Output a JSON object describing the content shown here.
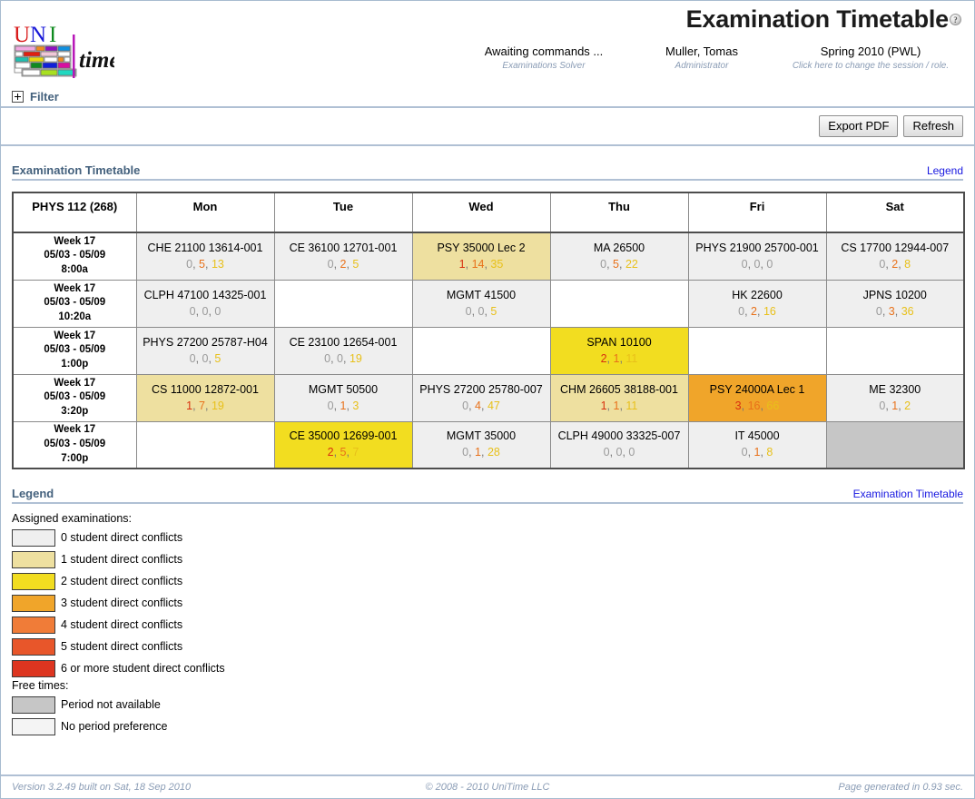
{
  "header": {
    "title": "Examination Timetable",
    "help_icon": "?",
    "status": [
      {
        "main": "Awaiting commands ...",
        "sub": "Examinations Solver"
      },
      {
        "main": "Muller, Tomas",
        "sub": "Administrator"
      },
      {
        "main": "Spring 2010 (PWL)",
        "sub": "Click here to change the session / role."
      }
    ]
  },
  "filter": {
    "label": "Filter"
  },
  "toolbar": {
    "export_label": "Export PDF",
    "refresh_label": "Refresh"
  },
  "timetable": {
    "section_title": "Examination Timetable",
    "section_link": "Legend",
    "corner_label": "PHYS 112 (268)",
    "days": [
      "Mon",
      "Tue",
      "Wed",
      "Thu",
      "Fri",
      "Sat"
    ],
    "rows": [
      {
        "week": "Week 17",
        "dates": "05/03 - 05/09",
        "time": "8:00a",
        "cells": [
          {
            "name": "CHE 21100 13614-001",
            "nums": [
              0,
              5,
              13
            ],
            "conflicts": 0
          },
          {
            "name": "CE 36100 12701-001",
            "nums": [
              0,
              2,
              5
            ],
            "conflicts": 0
          },
          {
            "name": "PSY 35000 Lec 2",
            "nums": [
              1,
              14,
              35
            ],
            "conflicts": 1
          },
          {
            "name": "MA 26500",
            "nums": [
              0,
              5,
              22
            ],
            "conflicts": 0
          },
          {
            "name": "PHYS 21900 25700-001",
            "nums": [
              0,
              0,
              0
            ],
            "conflicts": 0
          },
          {
            "name": "CS 17700 12944-007",
            "nums": [
              0,
              2,
              8
            ],
            "conflicts": 0
          }
        ]
      },
      {
        "week": "Week 17",
        "dates": "05/03 - 05/09",
        "time": "10:20a",
        "cells": [
          {
            "name": "CLPH 47100 14325-001",
            "nums": [
              0,
              0,
              0
            ],
            "conflicts": 0
          },
          {
            "name": "",
            "nums": null,
            "conflicts": null
          },
          {
            "name": "MGMT 41500",
            "nums": [
              0,
              0,
              5
            ],
            "conflicts": 0
          },
          {
            "name": "",
            "nums": null,
            "conflicts": null
          },
          {
            "name": "HK 22600",
            "nums": [
              0,
              2,
              16
            ],
            "conflicts": 0
          },
          {
            "name": "JPNS 10200",
            "nums": [
              0,
              3,
              36
            ],
            "conflicts": 0
          }
        ]
      },
      {
        "week": "Week 17",
        "dates": "05/03 - 05/09",
        "time": "1:00p",
        "cells": [
          {
            "name": "PHYS 27200 25787-H04",
            "nums": [
              0,
              0,
              5
            ],
            "conflicts": 0
          },
          {
            "name": "CE 23100 12654-001",
            "nums": [
              0,
              0,
              19
            ],
            "conflicts": 0
          },
          {
            "name": "",
            "nums": null,
            "conflicts": null
          },
          {
            "name": "SPAN 10100",
            "nums": [
              2,
              1,
              11
            ],
            "conflicts": 2
          },
          {
            "name": "",
            "nums": null,
            "conflicts": null
          },
          {
            "name": "",
            "nums": null,
            "conflicts": null
          }
        ]
      },
      {
        "week": "Week 17",
        "dates": "05/03 - 05/09",
        "time": "3:20p",
        "cells": [
          {
            "name": "CS 11000 12872-001",
            "nums": [
              1,
              7,
              19
            ],
            "conflicts": 1
          },
          {
            "name": "MGMT 50500",
            "nums": [
              0,
              1,
              3
            ],
            "conflicts": 0
          },
          {
            "name": "PHYS 27200 25780-007",
            "nums": [
              0,
              4,
              47
            ],
            "conflicts": 0
          },
          {
            "name": "CHM 26605 38188-001",
            "nums": [
              1,
              1,
              11
            ],
            "conflicts": 1
          },
          {
            "name": "PSY 24000A Lec 1",
            "nums": [
              3,
              16,
              66
            ],
            "conflicts": 3
          },
          {
            "name": "ME 32300",
            "nums": [
              0,
              1,
              2
            ],
            "conflicts": 0
          }
        ]
      },
      {
        "week": "Week 17",
        "dates": "05/03 - 05/09",
        "time": "7:00p",
        "cells": [
          {
            "name": "",
            "nums": null,
            "conflicts": null
          },
          {
            "name": "CE 35000 12699-001",
            "nums": [
              2,
              5,
              7
            ],
            "conflicts": 2
          },
          {
            "name": "MGMT 35000",
            "nums": [
              0,
              1,
              28
            ],
            "conflicts": 0
          },
          {
            "name": "CLPH 49000 33325-007",
            "nums": [
              0,
              0,
              0
            ],
            "conflicts": 0
          },
          {
            "name": "IT 45000",
            "nums": [
              0,
              1,
              8
            ],
            "conflicts": 0
          },
          {
            "name": "",
            "nums": null,
            "conflicts": null,
            "unavailable": true
          }
        ]
      }
    ]
  },
  "legend": {
    "section_title": "Legend",
    "section_link": "Examination Timetable",
    "groups": [
      {
        "caption": "Assigned examinations:",
        "items": [
          {
            "color": "#efefef",
            "label": "0 student direct conflicts"
          },
          {
            "color": "#eee0a0",
            "label": "1 student direct conflicts"
          },
          {
            "color": "#f2dd20",
            "label": "2 student direct conflicts"
          },
          {
            "color": "#f0a52a",
            "label": "3 student direct conflicts"
          },
          {
            "color": "#f07c38",
            "label": "4 student direct conflicts"
          },
          {
            "color": "#e8562a",
            "label": "5 student direct conflicts"
          },
          {
            "color": "#dd3520",
            "label": "6 or more student direct conflicts"
          }
        ]
      },
      {
        "caption": "Free times:",
        "items": [
          {
            "color": "#c6c6c6",
            "label": "Period not available"
          },
          {
            "color": "#f4f4f4",
            "label": "No period preference"
          }
        ]
      }
    ]
  },
  "colors": {
    "conflict_scale": [
      "#efefef",
      "#eee0a0",
      "#f2dd20",
      "#f0a52a",
      "#f07c38",
      "#e8562a",
      "#dd3520"
    ],
    "unavailable": "#c6c6c6",
    "empty": "#ffffff",
    "accent": "#44617d",
    "link": "#1818e0"
  },
  "footer": {
    "left": "Version 3.2.49 built on Sat, 18 Sep 2010",
    "center": "© 2008 - 2010 UniTime LLC",
    "right": "Page generated in 0.93 sec."
  }
}
